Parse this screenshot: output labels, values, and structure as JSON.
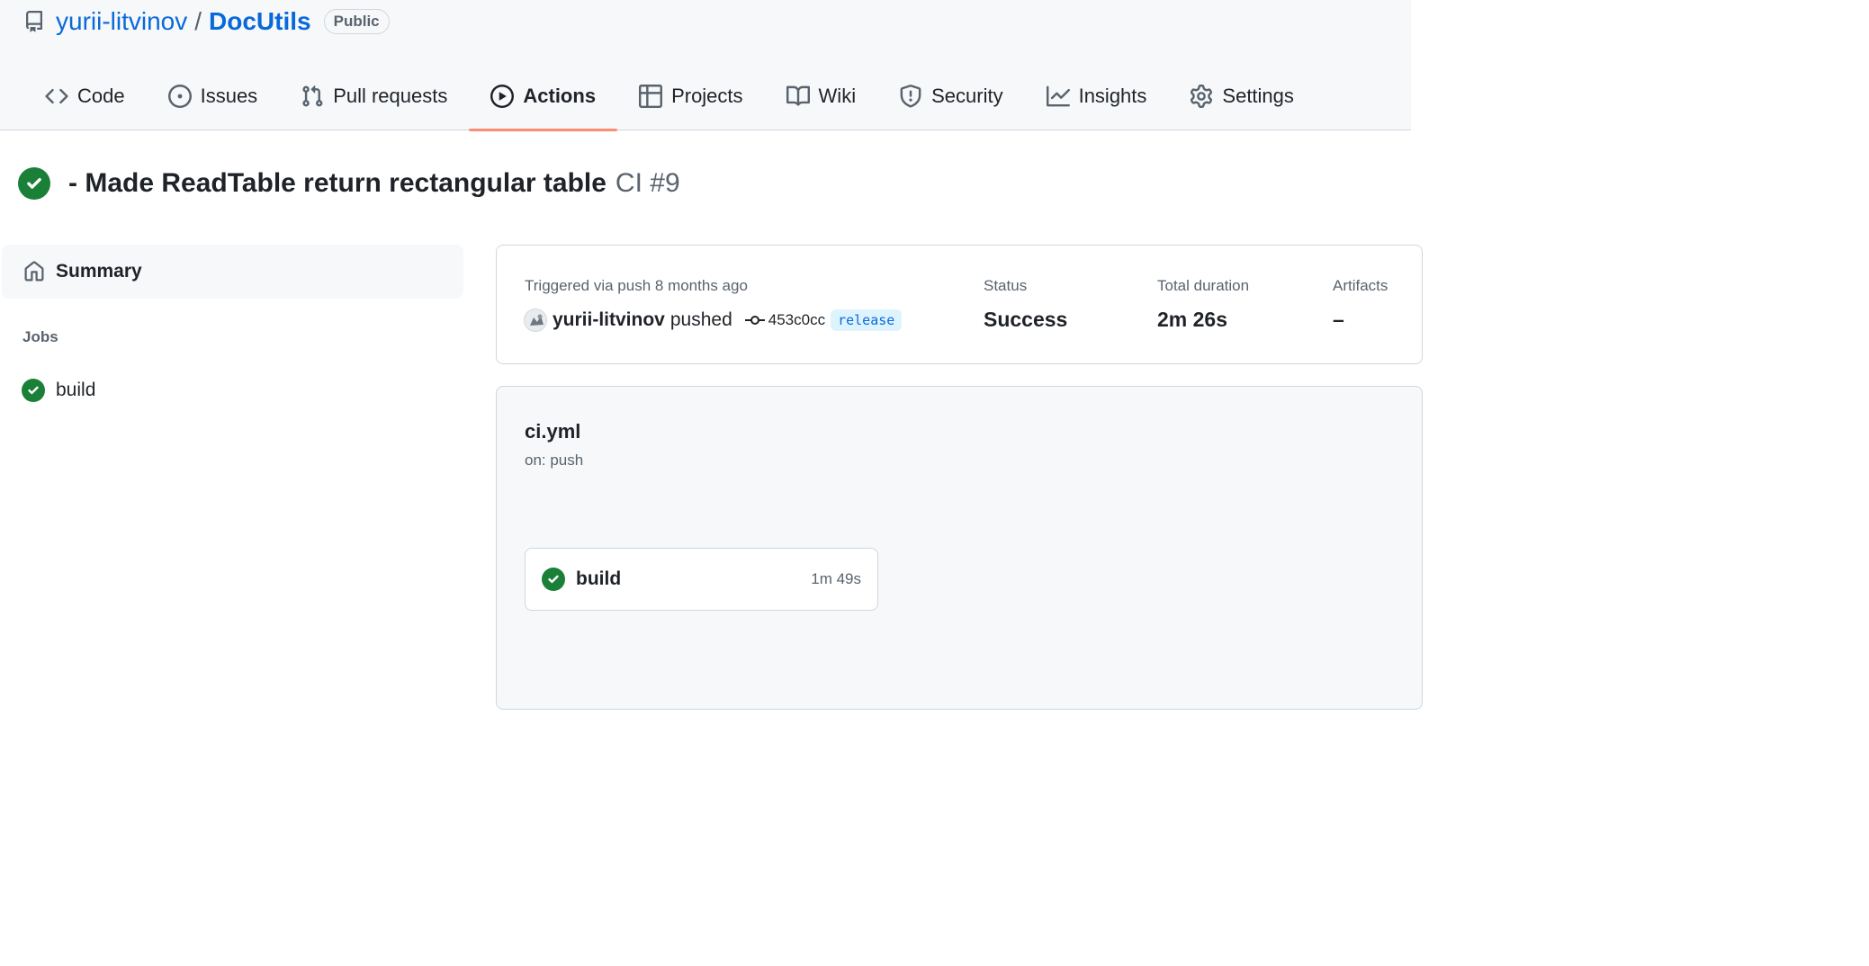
{
  "repo": {
    "owner": "yurii-litvinov",
    "separator": "/",
    "name": "DocUtils",
    "visibility": "Public"
  },
  "tabs": [
    {
      "label": "Code",
      "icon": "code-icon"
    },
    {
      "label": "Issues",
      "icon": "issue-icon"
    },
    {
      "label": "Pull requests",
      "icon": "pull-request-icon"
    },
    {
      "label": "Actions",
      "icon": "play-icon",
      "active": true
    },
    {
      "label": "Projects",
      "icon": "table-icon"
    },
    {
      "label": "Wiki",
      "icon": "book-icon"
    },
    {
      "label": "Security",
      "icon": "shield-icon"
    },
    {
      "label": "Insights",
      "icon": "graph-icon"
    },
    {
      "label": "Settings",
      "icon": "gear-icon"
    }
  ],
  "run": {
    "title": "- Made ReadTable return rectangular table",
    "workflow_run": "CI #9",
    "status_icon": "check-circle-icon"
  },
  "sidebar": {
    "summary_label": "Summary",
    "jobs_label": "Jobs",
    "jobs": [
      {
        "label": "build",
        "status": "success"
      }
    ]
  },
  "summary": {
    "trigger_label": "Triggered via push 8 months ago",
    "actor": "yurii-litvinov",
    "action": "pushed",
    "commit": "453c0cc",
    "branch": "release",
    "status_label": "Status",
    "status_value": "Success",
    "duration_label": "Total duration",
    "duration_value": "2m 26s",
    "artifacts_label": "Artifacts",
    "artifacts_value": "–"
  },
  "workflow": {
    "file": "ci.yml",
    "trigger": "on: push",
    "job": {
      "name": "build",
      "duration": "1m 49s"
    }
  },
  "colors": {
    "accent": "#0969da",
    "success": "#1a7f37",
    "tab_underline": "#fd8c73"
  }
}
